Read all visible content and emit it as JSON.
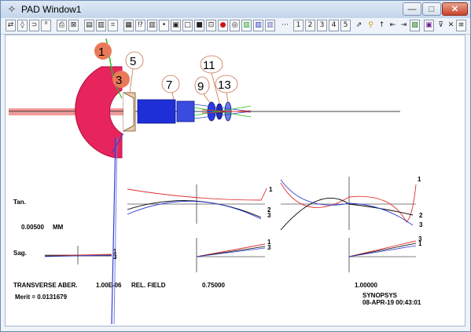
{
  "window": {
    "title": "PAD Window1",
    "minimize_glyph": "—",
    "maximize_glyph": "□",
    "close_glyph": "✕"
  },
  "toolbar": {
    "left_tools": [
      "⇄",
      "◊",
      "⊃",
      "⁰",
      "⎙",
      "⊠",
      "▤",
      "▥",
      "⌗",
      "▦",
      "⁉",
      "▥",
      "•",
      "▣",
      "□",
      "■",
      "⊡",
      "●",
      "◎",
      "▥",
      "▥",
      "▥"
    ],
    "dots_label": "⋯",
    "numbers": [
      "1",
      "2",
      "3",
      "4",
      "5"
    ],
    "right_tools": [
      "⇗",
      "⚲",
      "↑",
      "⇤",
      "⇥",
      "▨",
      "▣",
      "⊽",
      "✕",
      "≡"
    ]
  },
  "callouts": [
    "1",
    "3",
    "5",
    "7",
    "9",
    "11",
    "13"
  ],
  "fans": {
    "tan_label": "Tan.",
    "sag_label": "Sag.",
    "scale_label": "0.00500",
    "scale_unit": "MM",
    "tan_left_labels": [
      "1",
      "2",
      "3"
    ],
    "tan_right_labels": [
      "1",
      "2",
      "3"
    ],
    "sag_left_labels": [
      "1",
      "3"
    ],
    "sag_mid_labels": [
      "1",
      "3"
    ],
    "sag_right_labels": [
      "3",
      "1"
    ]
  },
  "footer": {
    "aberration_label": "TRANSVERSE ABER.",
    "aberration_value": "1.00E-06",
    "rel_field_label": "REL. FIELD",
    "field_1": "0.75000",
    "field_2": "1.00000",
    "merit": "Merit = 0.0131679",
    "program": "SYNOPSYS",
    "timestamp": "08-APR-19  00:43:01"
  },
  "colors": {
    "mirror": "#e8245c",
    "lens_blue": "#1e2fd8",
    "ray_red": "#e03030",
    "ray_green": "#22c022",
    "ray_blue": "#3040d0",
    "callout_fill": "#e87a5a"
  }
}
